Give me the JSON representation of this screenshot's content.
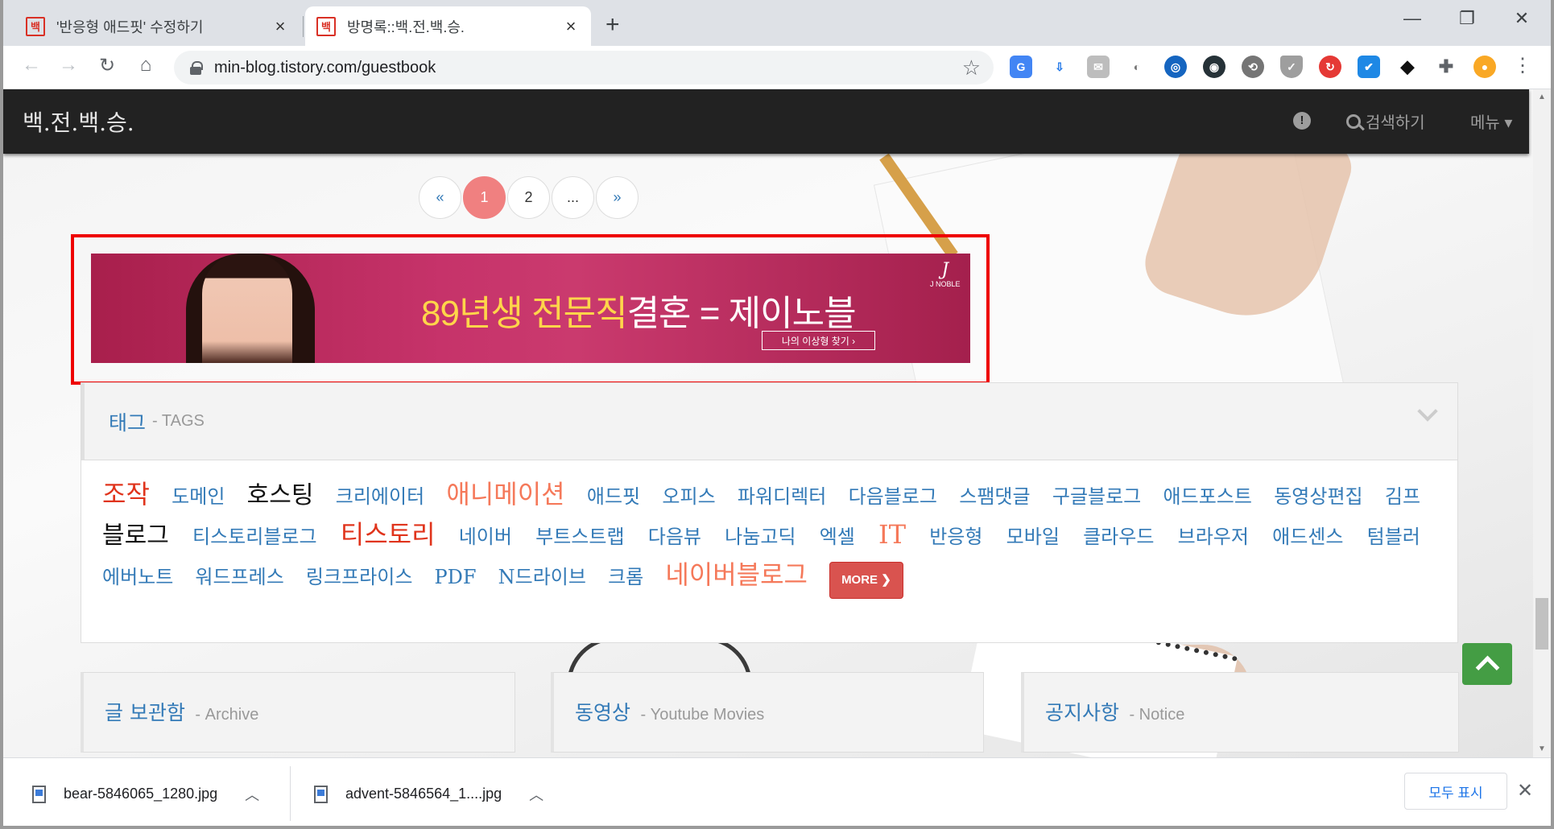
{
  "browser": {
    "tabs": [
      {
        "favicon": "백",
        "title": "'반응형 애드핏' 수정하기",
        "active": false
      },
      {
        "favicon": "백",
        "title": "방명록::백.전.백.승.",
        "active": true
      }
    ],
    "new_tab": "+",
    "url": "min-blog.tistory.com/guestbook",
    "extensions": [
      "translate-icon",
      "download-icon",
      "mail-icon",
      "mouse-icon",
      "globe-icon",
      "spy-icon",
      "share-icon",
      "shield-icon",
      "refresh-icon",
      "check-icon",
      "fish-icon",
      "puzzle-icon",
      "avatar"
    ]
  },
  "site": {
    "logo": "백.전.백.승.",
    "search_label": "검색하기",
    "menu_label": "메뉴 ▾"
  },
  "pagination": {
    "prev": "«",
    "pages": [
      "1",
      "2",
      "..."
    ],
    "current": "1",
    "next": "»"
  },
  "ad": {
    "headline_colored": "89년생 전문직",
    "headline_white": "결혼 = 제이노블",
    "button": "나의 이상형 찾기   ›",
    "brand": "J NOBLE"
  },
  "tags": {
    "title": "태그",
    "subtitle": "- TAGS",
    "items": [
      "조작",
      "도메인",
      "호스팅",
      "크리에이터",
      "애니메이션",
      "애드핏",
      "오피스",
      "파워디렉터",
      "다음블로그",
      "스팸댓글",
      "구글블로그",
      "애드포스트",
      "동영상편집",
      "김프",
      "블로그",
      "티스토리블로그",
      "티스토리",
      "네이버",
      "부트스트랩",
      "다음뷰",
      "나눔고딕",
      "엑셀",
      "IT",
      "반응형",
      "모바일",
      "클라우드",
      "브라우저",
      "애드센스",
      "텀블러",
      "에버노트",
      "워드프레스",
      "링크프라이스",
      "PDF",
      "N드라이브",
      "크롬",
      "네이버블로그"
    ],
    "more": "MORE ❯"
  },
  "boxes": [
    {
      "title": "글 보관함",
      "subtitle": "- Archive"
    },
    {
      "title": "동영상",
      "subtitle": "- Youtube Movies"
    },
    {
      "title": "공지사항",
      "subtitle": "- Notice"
    }
  ],
  "downloads": {
    "items": [
      "bear-5846065_1280.jpg",
      "advent-5846564_1....jpg"
    ],
    "show_all": "모두 표시"
  }
}
